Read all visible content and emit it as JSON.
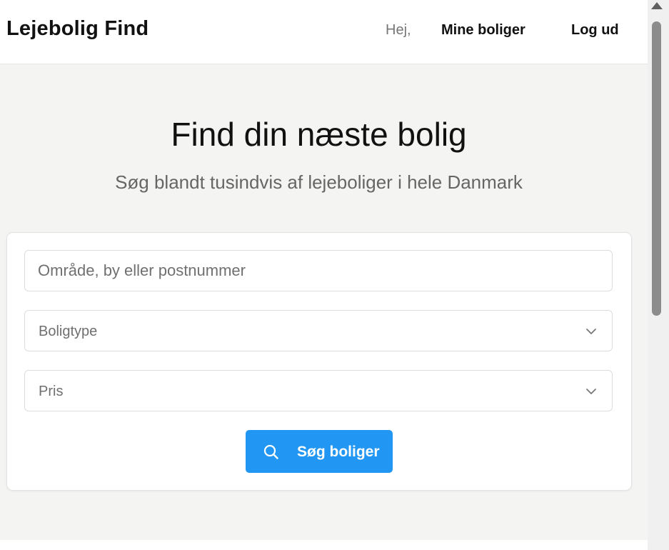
{
  "navbar": {
    "brand": "Lejebolig Find",
    "greeting": "Hej,",
    "links": [
      {
        "label": "Mine boliger"
      },
      {
        "label": "Log ud"
      }
    ]
  },
  "hero": {
    "title": "Find din næste bolig",
    "subtitle": "Søg blandt tusindvis af lejeboliger i hele Danmark"
  },
  "search_form": {
    "location": {
      "placeholder": "Område, by eller postnummer",
      "value": ""
    },
    "property_type": {
      "selected": "Boligtype",
      "icon": "chevron-down-icon"
    },
    "price": {
      "selected": "Pris",
      "icon": "chevron-down-icon"
    },
    "submit": {
      "label": "Søg boliger",
      "icon": "search-icon"
    }
  },
  "colors": {
    "accent": "#2196f3",
    "hero_background": "#f4f4f3",
    "text_primary": "#111111",
    "text_muted": "#666666"
  },
  "scrollbar": {
    "arrow_icon": "scroll-up-arrow-icon",
    "position": 0.0
  }
}
